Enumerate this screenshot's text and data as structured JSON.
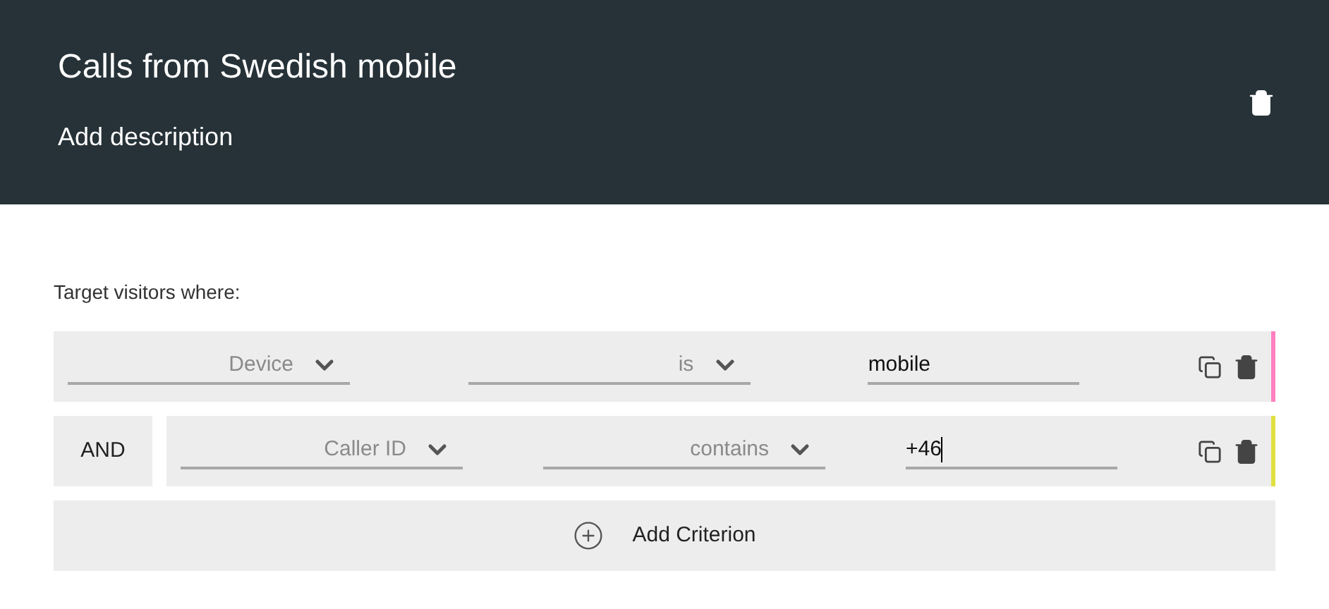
{
  "header": {
    "title": "Calls from Swedish mobile",
    "description": "Add description"
  },
  "criteria_label": "Target visitors where:",
  "criteria": [
    {
      "field": "Device",
      "operator": "is",
      "value": "mobile",
      "focused": false,
      "color": "#ff80c0"
    },
    {
      "connector": "AND",
      "field": "Caller ID",
      "operator": "contains",
      "value": "+46",
      "focused": true,
      "color": "#e0e040"
    }
  ],
  "add_button": "Add Criterion"
}
